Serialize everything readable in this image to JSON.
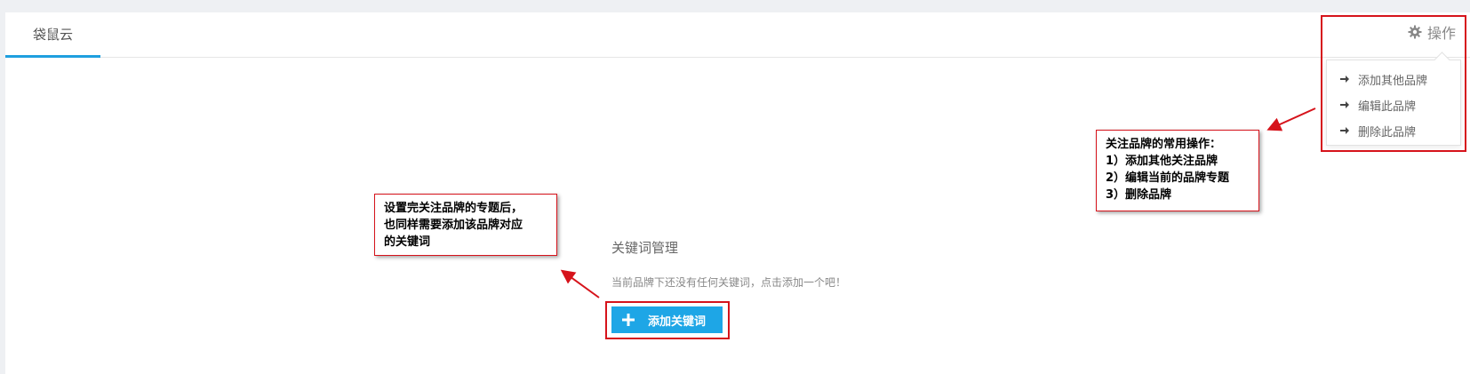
{
  "tab": {
    "label": "袋鼠云"
  },
  "operations": {
    "label": "操作",
    "menu": [
      {
        "label": "添加其他品牌"
      },
      {
        "label": "编辑此品牌"
      },
      {
        "label": "删除此品牌"
      }
    ]
  },
  "keywords": {
    "title": "关键词管理",
    "empty_text": "当前品牌下还没有任何关键词，点击添加一个吧！",
    "add_button": "添加关键词"
  },
  "annotations": {
    "left": {
      "lines": [
        "设置完关注品牌的专题后，",
        "也同样需要添加该品牌对应",
        "的关键词"
      ]
    },
    "right": {
      "lines": [
        "关注品牌的常用操作：",
        "1）添加其他关注品牌",
        "2）编辑当前的品牌专题",
        "3）删除品牌"
      ]
    }
  },
  "colors": {
    "accent": "#1ea6e6",
    "annotation_red": "#d6131b",
    "tab_underline": "#1e9fdf"
  }
}
